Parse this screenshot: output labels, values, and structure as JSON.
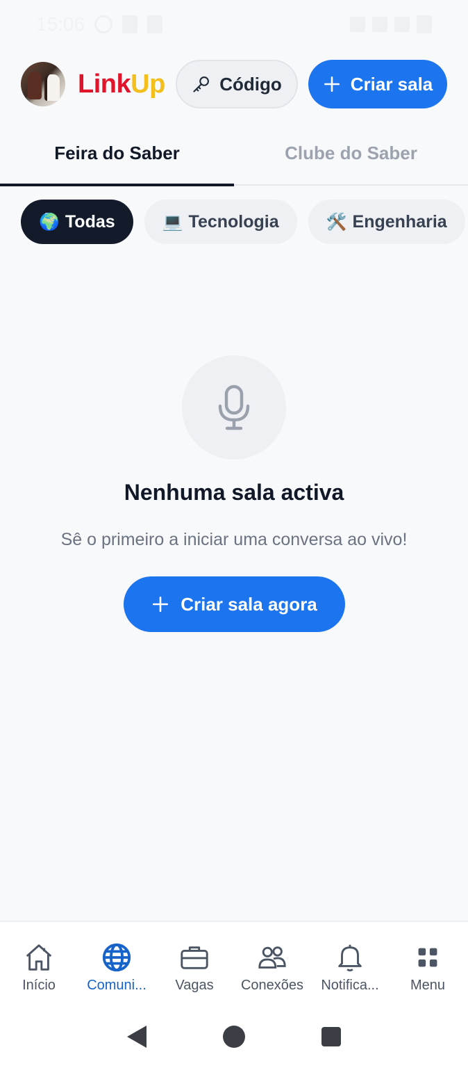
{
  "status_bar": {
    "time": "15:06"
  },
  "header": {
    "logo_part1": "Link",
    "logo_part2": "Up",
    "code_button": "Código",
    "create_button": "Criar sala",
    "colors": {
      "primary": "#1c74ee",
      "logo_red": "#e0142a",
      "logo_yellow": "#f4be1d"
    }
  },
  "tabs": [
    {
      "label": "Feira do Saber",
      "active": true
    },
    {
      "label": "Clube do Saber",
      "active": false
    }
  ],
  "categories": [
    {
      "emoji": "🌍",
      "label": "Todas",
      "active": true
    },
    {
      "emoji": "💻",
      "label": "Tecnologia",
      "active": false
    },
    {
      "emoji": "🛠️",
      "label": "Engenharia",
      "active": false
    }
  ],
  "empty_state": {
    "icon": "microphone-icon",
    "title": "Nenhuma sala activa",
    "subtitle": "Sê o primeiro a iniciar uma conversa ao vivo!",
    "button": "Criar sala agora"
  },
  "bottom_nav": [
    {
      "label": "Início",
      "icon": "home-icon",
      "active": false
    },
    {
      "label": "Comuni...",
      "icon": "globe-icon",
      "active": true
    },
    {
      "label": "Vagas",
      "icon": "briefcase-icon",
      "active": false
    },
    {
      "label": "Conexões",
      "icon": "people-icon",
      "active": false
    },
    {
      "label": "Notifica...",
      "icon": "bell-icon",
      "active": false
    },
    {
      "label": "Menu",
      "icon": "grid-icon",
      "active": false
    }
  ]
}
